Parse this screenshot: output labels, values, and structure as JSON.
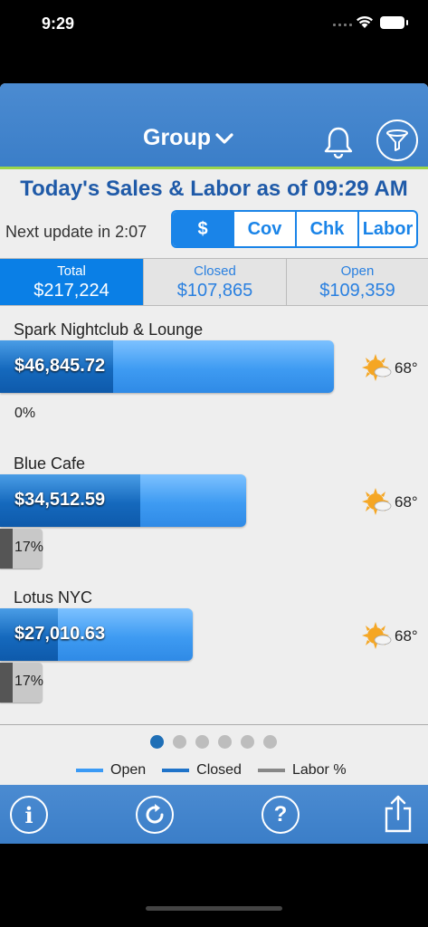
{
  "status_bar": {
    "time": "9:29"
  },
  "header": {
    "title": "Group"
  },
  "headline": "Today's Sales & Labor as of 09:29 AM",
  "update_text": "Next update in 2:07",
  "segments": [
    "$",
    "Cov",
    "Chk",
    "Labor"
  ],
  "selected_segment": "$",
  "totals": [
    {
      "label": "Total",
      "value": "$217,224"
    },
    {
      "label": "Closed",
      "value": "$107,865"
    },
    {
      "label": "Open",
      "value": "$109,359"
    }
  ],
  "locations": [
    {
      "name": "Spark Nightclub & Lounge",
      "amount": "$46,845.72",
      "total_value": 46845.72,
      "closed_fraction": 0.34,
      "temp": "68°",
      "labor_pct": "0%",
      "labor_value": 0
    },
    {
      "name": "Blue Cafe",
      "amount": "$34,512.59",
      "total_value": 34512.59,
      "closed_fraction": 0.57,
      "temp": "68°",
      "labor_pct": "17%",
      "labor_value": 17
    },
    {
      "name": "Lotus NYC",
      "amount": "$27,010.63",
      "total_value": 27010.63,
      "closed_fraction": 0.3,
      "temp": "68°",
      "labor_pct": "17%",
      "labor_value": 17
    }
  ],
  "pager": {
    "count": 6,
    "active": 0
  },
  "legend": [
    {
      "label": "Open",
      "color": "#3a9af5"
    },
    {
      "label": "Closed",
      "color": "#1f73c9"
    },
    {
      "label": "Labor %",
      "color": "#888888"
    }
  ],
  "colors": {
    "header_blue": "#4187cf",
    "accent_blue": "#1a84e8",
    "headline_blue": "#1f5aa8",
    "header_underline": "#9bd64a"
  }
}
